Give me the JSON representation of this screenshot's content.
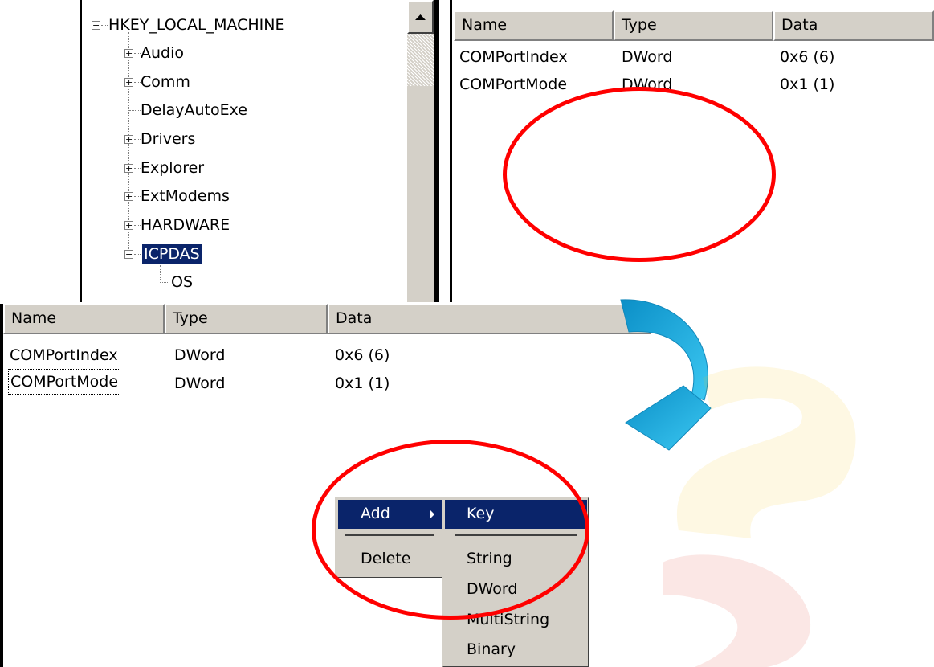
{
  "tree": {
    "root_label": "HKEY_LOCAL_MACHINE",
    "items": [
      {
        "label": "Audio"
      },
      {
        "label": "Comm"
      },
      {
        "label": "DelayAutoExe"
      },
      {
        "label": "Drivers"
      },
      {
        "label": "Explorer"
      },
      {
        "label": "ExtModems"
      },
      {
        "label": "HARDWARE"
      },
      {
        "label": "ICPDAS"
      },
      {
        "label": "OS"
      }
    ]
  },
  "top_list": {
    "columns": [
      "Name",
      "Type",
      "Data"
    ],
    "rows": [
      {
        "name": "COMPortIndex",
        "type": "DWord",
        "data": "0x6 (6)"
      },
      {
        "name": "COMPortMode",
        "type": "DWord",
        "data": "0x1 (1)"
      }
    ]
  },
  "bottom_list": {
    "columns": [
      "Name",
      "Type",
      "Data"
    ],
    "rows": [
      {
        "name": "COMPortIndex",
        "type": "DWord",
        "data": "0x6 (6)"
      },
      {
        "name": "COMPortMode",
        "type": "DWord",
        "data": "0x1 (1)"
      }
    ]
  },
  "context_menu": {
    "add": "Add",
    "delete": "Delete"
  },
  "submenu": {
    "key": "Key",
    "string": "String",
    "dword": "DWord",
    "multistring": "MultiString",
    "binary": "Binary"
  },
  "colors": {
    "highlight": "#0a246a",
    "annotation_red": "#ff0000",
    "arrow_blue": "#1ab0e0"
  },
  "icons": [
    "plus-expander-icon",
    "minus-expander-icon",
    "submenu-arrow-icon",
    "curved-arrow-icon",
    "scroll-up-icon"
  ]
}
